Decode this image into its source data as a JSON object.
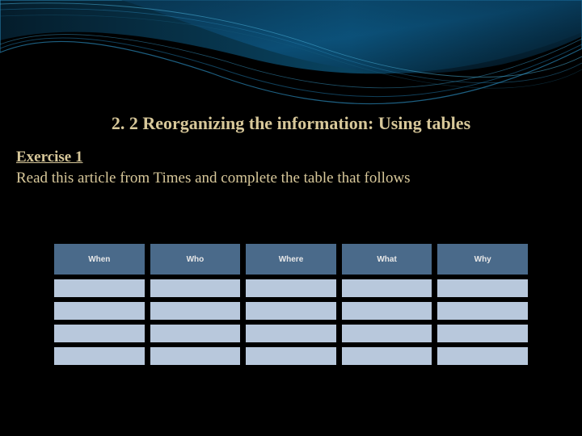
{
  "title": "2. 2 Reorganizing the information: Using tables",
  "exercise_label": "Exercise 1",
  "instruction": "Read this article from Times and complete the table that follows",
  "table": {
    "headers": [
      "When",
      "Who",
      "Where",
      "What",
      "Why"
    ],
    "rows": [
      [
        "",
        "",
        "",
        "",
        ""
      ],
      [
        "",
        "",
        "",
        "",
        ""
      ],
      [
        "",
        "",
        "",
        "",
        ""
      ],
      [
        "",
        "",
        "",
        "",
        ""
      ]
    ]
  },
  "chart_data": {
    "type": "table",
    "title": "Reorganizing the information: Using tables",
    "columns": [
      "When",
      "Who",
      "Where",
      "What",
      "Why"
    ],
    "rows": [
      [
        "",
        "",
        "",
        "",
        ""
      ],
      [
        "",
        "",
        "",
        "",
        ""
      ],
      [
        "",
        "",
        "",
        "",
        ""
      ],
      [
        "",
        "",
        "",
        "",
        ""
      ]
    ]
  }
}
